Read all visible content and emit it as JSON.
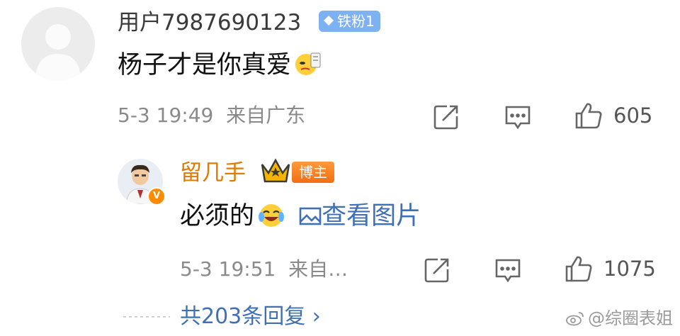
{
  "comment": {
    "username": "用户7987690123",
    "fan_badge": "铁粉1",
    "content": "杨子才是你真爱",
    "emoji": "smirk-emoji",
    "date": "5-3 19:49",
    "location": "来自广东",
    "like_count": "605",
    "icons": [
      "share-icon",
      "comment-icon",
      "like-icon"
    ]
  },
  "reply": {
    "username": "留几手",
    "badge": "博主",
    "content": "必须的",
    "emoji": "laugh-cry-emoji",
    "view_image": "查看图片",
    "date": "5-3 19:51",
    "location": "来自…",
    "like_count": "1075",
    "icons": [
      "share-icon",
      "comment-icon",
      "like-icon"
    ]
  },
  "replies_link": "共203条回复 ›",
  "watermark": "@综圈表姐",
  "colors": {
    "username_orange": "#e07a00",
    "link_blue": "#3f6fb5",
    "meta_gray": "#8a8a8a"
  }
}
